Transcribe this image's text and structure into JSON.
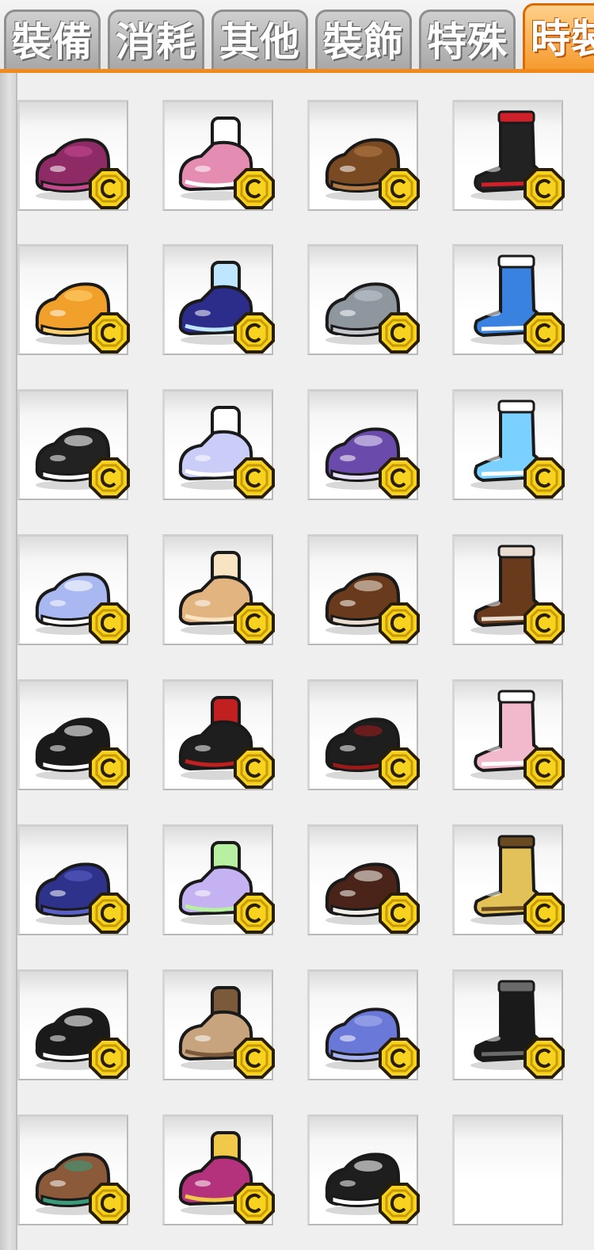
{
  "tabs": [
    {
      "label": "裝備",
      "active": false
    },
    {
      "label": "消耗",
      "active": false
    },
    {
      "label": "其他",
      "active": false
    },
    {
      "label": "裝飾",
      "active": false
    },
    {
      "label": "特殊",
      "active": false
    },
    {
      "label": "時裝",
      "active": true
    }
  ],
  "inventory": {
    "slots": [
      {
        "icon": "plum-loafer-icon",
        "cash": true,
        "colors": [
          "#8e2a66",
          "#c44a8e"
        ]
      },
      {
        "icon": "pink-bow-shoe-icon",
        "cash": true,
        "colors": [
          "#e48cb2",
          "#ffffff"
        ]
      },
      {
        "icon": "brown-loafer-icon",
        "cash": true,
        "colors": [
          "#7a4a22",
          "#b27a44"
        ]
      },
      {
        "icon": "black-red-bow-shoe-icon",
        "cash": true,
        "colors": [
          "#222222",
          "#d0202a"
        ]
      },
      {
        "icon": "orange-slipper-icon",
        "cash": true,
        "colors": [
          "#f2a02c",
          "#ffd070"
        ]
      },
      {
        "icon": "pig-sock-night-icon",
        "cash": true,
        "colors": [
          "#2c2c8a",
          "#bfe6ff"
        ]
      },
      {
        "icon": "grey-slouch-boot-icon",
        "cash": true,
        "colors": [
          "#8e969e",
          "#c2c8ce"
        ]
      },
      {
        "icon": "blue-white-sandal-icon",
        "cash": true,
        "colors": [
          "#3a82e0",
          "#ffffff"
        ]
      },
      {
        "icon": "black-white-mary-jane-icon",
        "cash": true,
        "colors": [
          "#222222",
          "#ffffff"
        ]
      },
      {
        "icon": "sparkle-cherry-sock-icon",
        "cash": true,
        "colors": [
          "#c9cdf7",
          "#ffffff"
        ]
      },
      {
        "icon": "purple-star-sparkle-icon",
        "cash": true,
        "colors": [
          "#6a4aaa",
          "#e6e0f6"
        ]
      },
      {
        "icon": "pearl-cloud-shoe-icon",
        "cash": true,
        "colors": [
          "#7ad0ff",
          "#ffffff"
        ]
      },
      {
        "icon": "lavender-slip-on-icon",
        "cash": true,
        "colors": [
          "#a9b8f0",
          "#ffffff"
        ]
      },
      {
        "icon": "tan-ankle-shoe-icon",
        "cash": true,
        "colors": [
          "#e2b480",
          "#f8e4c2"
        ]
      },
      {
        "icon": "brown-ankle-boot-sock-icon",
        "cash": true,
        "colors": [
          "#6a3a1c",
          "#e8ddd0"
        ]
      },
      {
        "icon": "brown-buckle-boot-sock-icon",
        "cash": true,
        "colors": [
          "#6a3a1c",
          "#e8ddd0"
        ]
      },
      {
        "icon": "black-white-strap-shoe-icon",
        "cash": true,
        "colors": [
          "#1a1a1a",
          "#ffffff"
        ]
      },
      {
        "icon": "black-red-cuff-boot-icon",
        "cash": true,
        "colors": [
          "#1e1e1e",
          "#c02020"
        ]
      },
      {
        "icon": "black-red-sole-boot-icon",
        "cash": true,
        "colors": [
          "#1e1e1e",
          "#9a1a1a"
        ]
      },
      {
        "icon": "pink-bunny-slipper-icon",
        "cash": true,
        "colors": [
          "#f2b8cc",
          "#ffffff"
        ]
      },
      {
        "icon": "navy-rain-boot-icon",
        "cash": true,
        "colors": [
          "#2e328a",
          "#5a60c8"
        ]
      },
      {
        "icon": "flower-lilac-sandal-icon",
        "cash": true,
        "colors": [
          "#c4b2f2",
          "#b6f0a0"
        ]
      },
      {
        "icon": "brown-white-pair-boot-icon",
        "cash": true,
        "colors": [
          "#4a2418",
          "#f2eeea"
        ]
      },
      {
        "icon": "yellow-fur-boot-icon",
        "cash": true,
        "colors": [
          "#e2c258",
          "#6a4a20"
        ]
      },
      {
        "icon": "black-white-sandal-icon",
        "cash": true,
        "colors": [
          "#1a1a1a",
          "#ffffff"
        ]
      },
      {
        "icon": "tan-desert-boot-icon",
        "cash": true,
        "colors": [
          "#c8a47e",
          "#7a5a3a"
        ]
      },
      {
        "icon": "periwinkle-loafer-icon",
        "cash": true,
        "colors": [
          "#6a78d8",
          "#a8b2ee"
        ]
      },
      {
        "icon": "black-buckle-boot-icon",
        "cash": true,
        "colors": [
          "#1a1a1a",
          "#6a6a6a"
        ]
      },
      {
        "icon": "brown-teal-boot-icon",
        "cash": true,
        "colors": [
          "#8a5a3a",
          "#3a9a7a"
        ]
      },
      {
        "icon": "magenta-slipper-icon",
        "cash": true,
        "colors": [
          "#b4327c",
          "#f0c84a"
        ]
      },
      {
        "icon": "white-sock-black-shoe-icon",
        "cash": true,
        "colors": [
          "#1e1e1e",
          "#ffffff"
        ]
      },
      {
        "icon": "empty-slot",
        "cash": false,
        "colors": [
          "#ffffff",
          "#ffffff"
        ]
      }
    ]
  },
  "coin_colors": {
    "gold": "#f7d21e",
    "outline": "#2a1e00",
    "shade": "#c79a00"
  }
}
